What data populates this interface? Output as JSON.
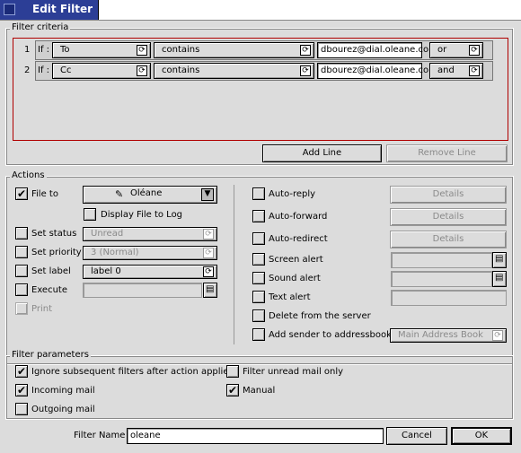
{
  "window": {
    "title": "Edit Filter"
  },
  "filter_criteria": {
    "legend": "Filter criteria",
    "rows": [
      {
        "num": "1",
        "if_label": "If :",
        "field": "To",
        "operator": "contains",
        "value": "dbourez@dial.oleane.co",
        "conj": "or"
      },
      {
        "num": "2",
        "if_label": "If :",
        "field": "Cc",
        "operator": "contains",
        "value": "dbourez@dial.oleane.co",
        "conj": "and"
      }
    ],
    "add_line": "Add Line",
    "remove_line": "Remove Line"
  },
  "actions": {
    "legend": "Actions",
    "file_to": {
      "label": "File to",
      "checked": true,
      "folder": "Oléane"
    },
    "display_file_to_log": {
      "label": "Display File to Log",
      "checked": false
    },
    "set_status": {
      "label": "Set status",
      "value": "Unread"
    },
    "set_priority": {
      "label": "Set priority",
      "value": "3 (Normal)"
    },
    "set_label": {
      "label": "Set label",
      "value": "label 0"
    },
    "execute": {
      "label": "Execute",
      "value": ""
    },
    "print": {
      "label": "Print"
    },
    "auto_reply": {
      "label": "Auto-reply",
      "details": "Details"
    },
    "auto_forward": {
      "label": "Auto-forward",
      "details": "Details"
    },
    "auto_redirect": {
      "label": "Auto-redirect",
      "details": "Details"
    },
    "screen_alert": {
      "label": "Screen alert",
      "value": ""
    },
    "sound_alert": {
      "label": "Sound alert",
      "value": ""
    },
    "text_alert": {
      "label": "Text alert",
      "value": ""
    },
    "delete_from_server": {
      "label": "Delete from the server"
    },
    "add_sender": {
      "label": "Add sender to addressbook",
      "book": "Main Address Book"
    }
  },
  "filter_parameters": {
    "legend": "Filter parameters",
    "ignore_subsequent": {
      "label": "Ignore subsequent filters after action applied",
      "checked": true
    },
    "filter_unread_only": {
      "label": "Filter unread mail only",
      "checked": false
    },
    "incoming_mail": {
      "label": "Incoming mail",
      "checked": true
    },
    "manual": {
      "label": "Manual",
      "checked": true
    },
    "outgoing_mail": {
      "label": "Outgoing mail",
      "checked": false
    }
  },
  "footer": {
    "filter_name_label": "Filter Name",
    "filter_name_value": "oleane",
    "cancel": "Cancel",
    "ok": "OK"
  },
  "icons": {
    "check": "✔",
    "popup_arrow": "⟳",
    "file_picker": "🗎",
    "folder": "folder-icon"
  }
}
